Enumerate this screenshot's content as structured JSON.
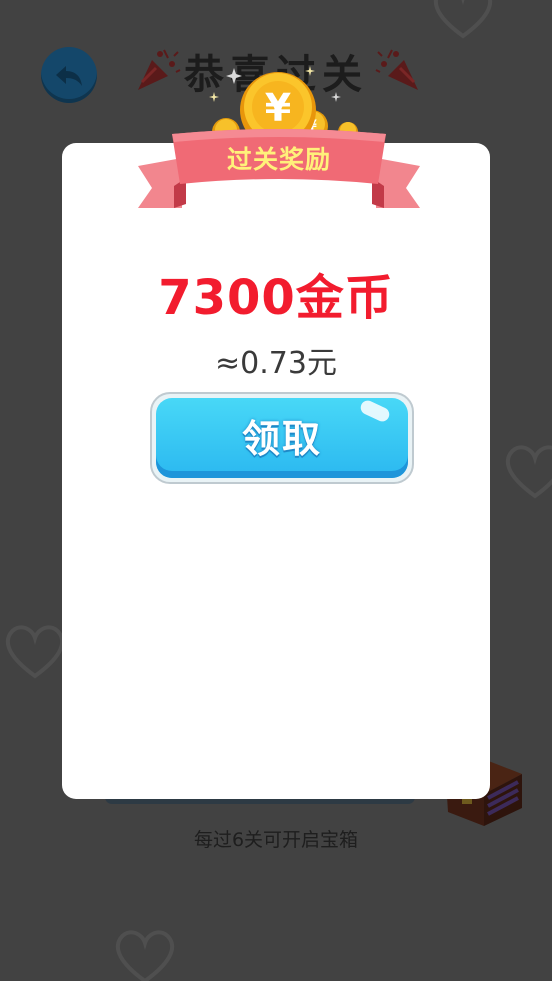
{
  "background": {
    "title": "恭喜过关",
    "hint": "每过6关可开启宝箱"
  },
  "modal": {
    "banner": "过关奖励",
    "reward_amount": "7300金币",
    "reward_approx": "≈0.73元",
    "claim_label": "领取"
  },
  "colors": {
    "overlay": "#424242",
    "reward_red": "#f21c2e",
    "button_blue": "#2bb8f0",
    "ribbon_pink": "#f06a75",
    "banner_text": "#fff17a"
  },
  "icons": {
    "back": "back-arrow-icon",
    "popper": "party-popper-icon",
    "coins": "coin-stack-icon",
    "chest": "treasure-chest-icon",
    "heart": "heart-icon"
  }
}
